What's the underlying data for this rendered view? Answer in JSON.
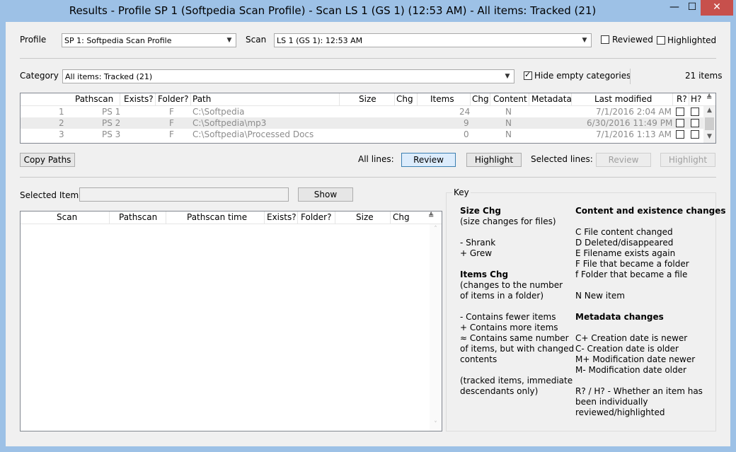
{
  "window": {
    "title": "Results - Profile SP 1 (Softpedia Scan Profile) - Scan LS 1 (GS 1) (12:53 AM) - All items: Tracked (21)",
    "minimize": "—",
    "maximize": "☐",
    "close": "✕"
  },
  "profile": {
    "label": "Profile",
    "value": "SP 1: Softpedia Scan Profile"
  },
  "scan": {
    "label": "Scan",
    "value": "LS 1 (GS 1): 12:53 AM"
  },
  "filters": {
    "reviewed": "Reviewed",
    "highlighted": "Highlighted"
  },
  "category": {
    "label": "Category",
    "value": "All items: Tracked (21)",
    "hide_empty": "Hide empty categories",
    "count": "21 items"
  },
  "items_grid": {
    "columns": [
      "Pathscan",
      "Exists?",
      "Folder?",
      "Path",
      "Size",
      "Chg",
      "Items",
      "Chg",
      "Content",
      "Metadata",
      "Last modified",
      "R?",
      "H?"
    ],
    "rows": [
      {
        "num": "1",
        "pathscan": "PS 1",
        "folder": "F",
        "path": "C:\\Softpedia",
        "items": "24",
        "content": "N",
        "modified": "7/1/2016 2:04 AM"
      },
      {
        "num": "2",
        "pathscan": "PS 2",
        "folder": "F",
        "path": "C:\\Softpedia\\mp3",
        "items": "9",
        "content": "N",
        "modified": "6/30/2016 11:49 PM"
      },
      {
        "num": "3",
        "pathscan": "PS 3",
        "folder": "F",
        "path": "C:\\Softpedia\\Processed Docs",
        "items": "0",
        "content": "N",
        "modified": "7/1/2016 1:13 AM"
      }
    ]
  },
  "actions": {
    "copy_paths": "Copy Paths",
    "all_lines": "All lines:",
    "review": "Review",
    "highlight": "Highlight",
    "selected_lines": "Selected lines:",
    "sel_review": "Review",
    "sel_highlight": "Highlight"
  },
  "selected_item": {
    "label": "Selected Item",
    "value": "",
    "show": "Show",
    "columns": [
      "Scan",
      "Pathscan",
      "Pathscan time",
      "Exists?",
      "Folder?",
      "Size",
      "Chg"
    ]
  },
  "key": {
    "title": "Key",
    "left": [
      {
        "text": "Size Chg",
        "bold": true
      },
      {
        "text": "(size changes for files)"
      },
      {
        "text": ""
      },
      {
        "text": "- Shrank"
      },
      {
        "text": "+ Grew"
      },
      {
        "text": ""
      },
      {
        "text": "Items Chg",
        "bold": true
      },
      {
        "text": "(changes to the number"
      },
      {
        "text": "of items in a folder)"
      },
      {
        "text": ""
      },
      {
        "text": "- Contains fewer items"
      },
      {
        "text": "+ Contains more items"
      },
      {
        "text": "≈ Contains same number"
      },
      {
        "text": "of items, but with changed"
      },
      {
        "text": "contents"
      },
      {
        "text": ""
      },
      {
        "text": "(tracked items, immediate"
      },
      {
        "text": "descendants only)"
      }
    ],
    "right": [
      {
        "text": "Content and existence changes",
        "bold": true
      },
      {
        "text": ""
      },
      {
        "text": "C File content changed"
      },
      {
        "text": "D Deleted/disappeared"
      },
      {
        "text": "E Filename exists again"
      },
      {
        "text": "F File that became a folder"
      },
      {
        "text": "f Folder that became a file"
      },
      {
        "text": ""
      },
      {
        "text": "N New item"
      },
      {
        "text": ""
      },
      {
        "text": "Metadata changes",
        "bold": true
      },
      {
        "text": ""
      },
      {
        "text": "C+ Creation date is newer"
      },
      {
        "text": "C- Creation date is older"
      },
      {
        "text": "M+ Modification date newer"
      },
      {
        "text": "M- Modification date older"
      },
      {
        "text": ""
      },
      {
        "text": "R? / H? - Whether an item has"
      },
      {
        "text": "been individually"
      },
      {
        "text": "reviewed/highlighted"
      }
    ]
  }
}
